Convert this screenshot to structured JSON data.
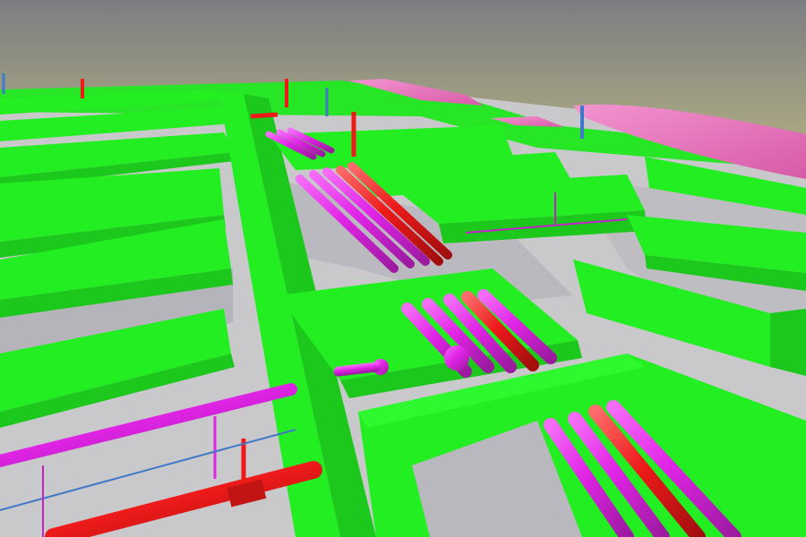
{
  "scene": {
    "kind": "3d-bim-model-render",
    "subject": "building-services-coordination",
    "colors": {
      "sky_top": "#7f8083",
      "sky_horizon": "#a8a682",
      "slab": "#c9c9cc",
      "slab_shadow": "#9d9da3",
      "beam": "#22ee22",
      "beam_side": "#1bc81b",
      "beam_edge": "#14a014",
      "pipe_magenta": "#e024e6",
      "pipe_magenta_dark": "#9c1aa0",
      "pipe_red": "#ee1a1a",
      "pipe_red_dark": "#a20e0e",
      "pink_roof": "#ef78c4",
      "blue_conduit": "#3f78c8"
    }
  }
}
